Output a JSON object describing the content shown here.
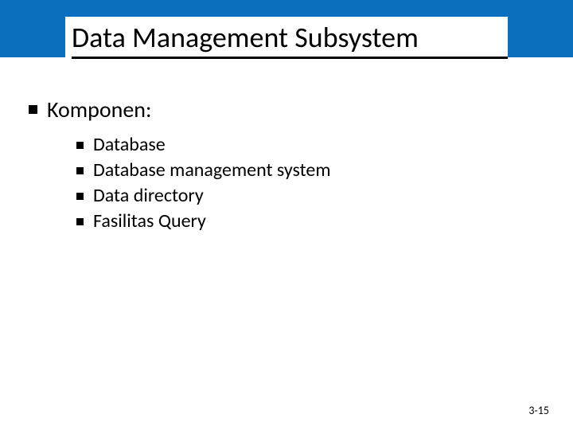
{
  "slide": {
    "title": "Data Management Subsystem",
    "heading": "Komponen:",
    "items": [
      "Database",
      "Database management system",
      "Data directory",
      "Fasilitas Query"
    ],
    "page_number": "3-15"
  }
}
